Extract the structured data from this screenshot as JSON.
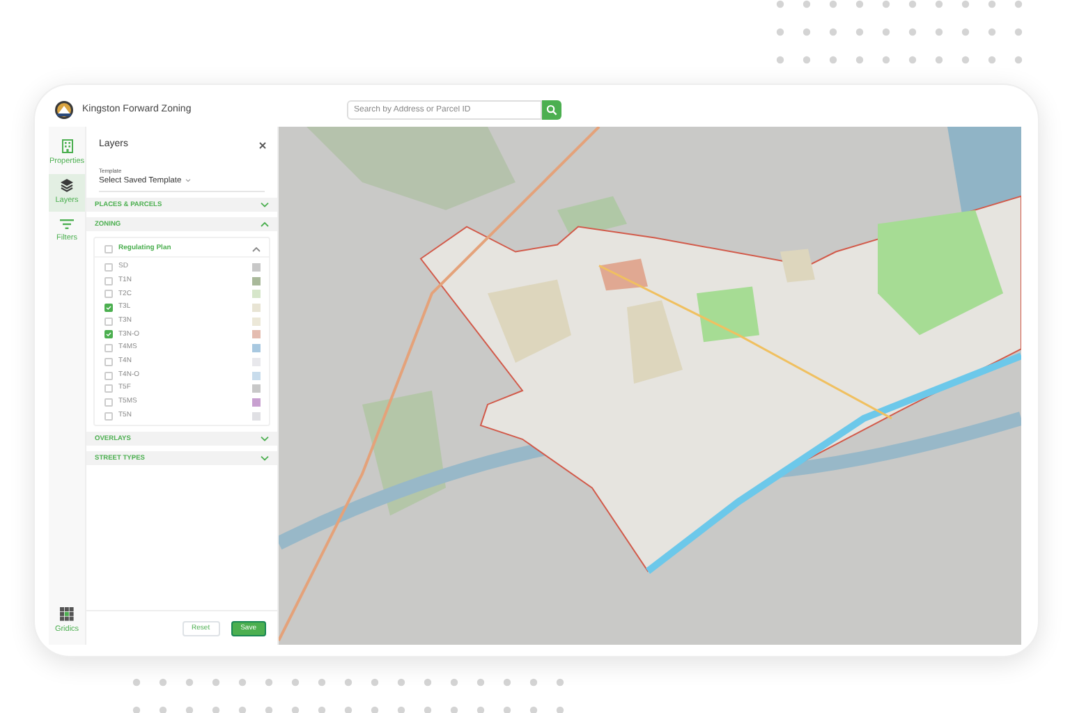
{
  "app": {
    "title": "Kingston Forward Zoning"
  },
  "search": {
    "placeholder": "Search by Address or Parcel ID"
  },
  "rail": [
    {
      "label": "Properties",
      "kind": "building",
      "selected": false
    },
    {
      "label": "Layers",
      "kind": "layers",
      "selected": true
    },
    {
      "label": "Filters",
      "kind": "filter",
      "selected": false
    }
  ],
  "rail_footer": {
    "label": "Gridics"
  },
  "panel": {
    "title": "Layers",
    "template_label": "Template",
    "template_value": "Select Saved Template",
    "sections": [
      {
        "title": "PLACES & PARCELS",
        "expanded": false
      },
      {
        "title": "ZONING",
        "expanded": true,
        "groups": [
          {
            "title": "Regulating Plan",
            "checked": false,
            "expanded": true,
            "items": [
              {
                "label": "SD",
                "checked": false,
                "color": "#c8c8c8"
              },
              {
                "label": "T1N",
                "checked": false,
                "color": "#a9b99a"
              },
              {
                "label": "T2C",
                "checked": false,
                "color": "#d6e6ca"
              },
              {
                "label": "T3L",
                "checked": true,
                "color": "#e8e4d4"
              },
              {
                "label": "T3N",
                "checked": false,
                "color": "#ece8d8"
              },
              {
                "label": "T3N-O",
                "checked": true,
                "color": "#e4bcb0"
              },
              {
                "label": "T4MS",
                "checked": false,
                "color": "#a8c8e0"
              },
              {
                "label": "T4N",
                "checked": false,
                "color": "#e8e8ec"
              },
              {
                "label": "T4N-O",
                "checked": false,
                "color": "#c8dcec"
              },
              {
                "label": "T5F",
                "checked": false,
                "color": "#c8c8c8"
              },
              {
                "label": "T5MS",
                "checked": false,
                "color": "#c8a0d0"
              },
              {
                "label": "T5N",
                "checked": false,
                "color": "#e0e0e4"
              }
            ]
          }
        ]
      },
      {
        "title": "OVERLAYS",
        "expanded": false
      },
      {
        "title": "STREET TYPES",
        "expanded": false
      }
    ],
    "buttons": [
      {
        "label": "Reset",
        "kind": "secondary"
      },
      {
        "label": "Save",
        "kind": "primary"
      }
    ]
  }
}
